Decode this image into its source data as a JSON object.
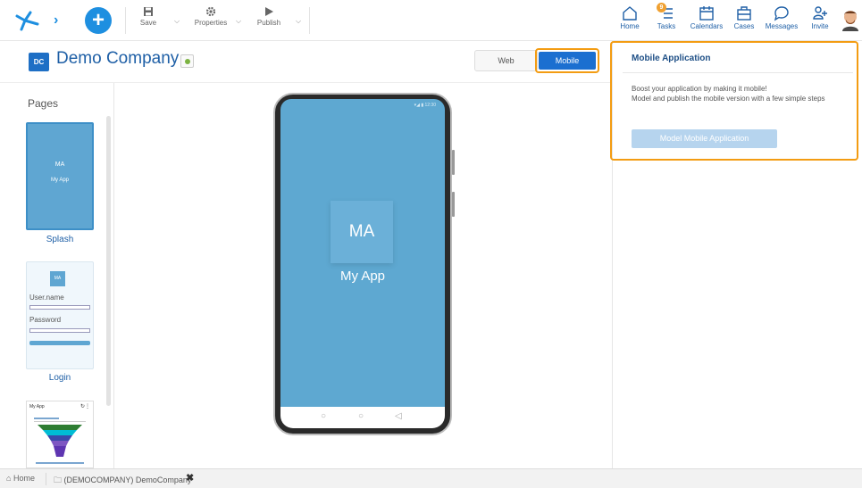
{
  "toolbar": {
    "save_label": "Save",
    "properties_label": "Properties",
    "publish_label": "Publish",
    "dropdown_glyph": "⌵",
    "chevron_glyph": "›",
    "plus_glyph": "+"
  },
  "nav": {
    "home": "Home",
    "tasks": "Tasks",
    "tasks_badge": "9",
    "calendars": "Calendars",
    "cases": "Cases",
    "messages": "Messages",
    "invite": "Invite"
  },
  "header": {
    "company_initials": "DC",
    "company_name": "Demo Company",
    "web_label": "Web",
    "mobile_label": "Mobile"
  },
  "sidebar": {
    "title": "Pages",
    "pages": [
      {
        "label": "Splash",
        "thumb_initials": "MA",
        "thumb_name": "My App"
      },
      {
        "label": "Login",
        "thumb_initials": "MA",
        "username_label": "User.name",
        "password_label": "Password"
      },
      {
        "thumb_title": "My App"
      }
    ]
  },
  "preview": {
    "status_time": "12:30",
    "app_initials": "MA",
    "app_name": "My App",
    "nav_glyphs": [
      "○",
      "○",
      "◁"
    ]
  },
  "panel": {
    "title": "Mobile Application",
    "line1": "Boost your application by making it mobile!",
    "line2": "Model and publish the mobile version with a few simple steps",
    "button": "Model Mobile Application"
  },
  "footer": {
    "home_tab": "Home",
    "workspace_tab": "(DEMOCOMPANY) DemoCompany",
    "close_glyph": "✖"
  },
  "colors": {
    "accent": "#1e5fa6",
    "primary_button": "#1b6fd0",
    "highlight_outline": "#f39c12",
    "splash_blue": "#5ea8d1",
    "status_green": "#7cb342"
  },
  "icons": [
    "logo-icon",
    "chevron-right-icon",
    "plus-icon",
    "save-icon",
    "gear-icon",
    "play-icon",
    "home-icon",
    "tasks-icon",
    "calendar-icon",
    "briefcase-icon",
    "chat-icon",
    "add-user-icon",
    "avatar",
    "folder-icon",
    "close-icon"
  ]
}
